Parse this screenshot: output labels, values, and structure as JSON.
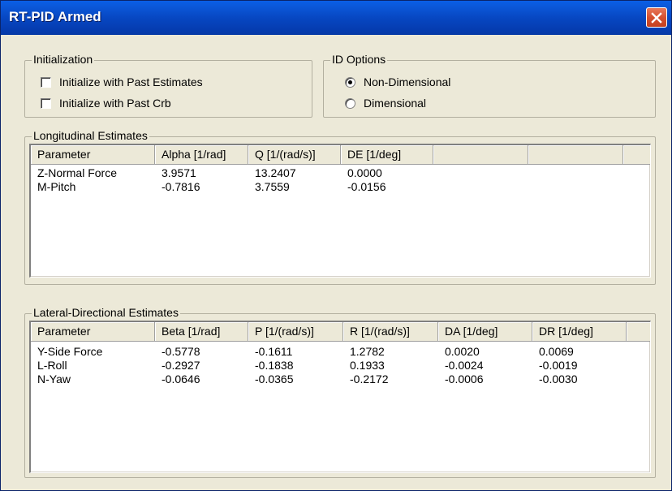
{
  "window": {
    "title": "RT-PID Armed"
  },
  "initialization": {
    "title": "Initialization",
    "options": [
      {
        "label": "Initialize with Past Estimates",
        "checked": false
      },
      {
        "label": "Initialize with Past Crb",
        "checked": false
      }
    ]
  },
  "id_options": {
    "title": "ID Options",
    "options": [
      {
        "label": "Non-Dimensional",
        "selected": true
      },
      {
        "label": "Dimensional",
        "selected": false
      }
    ]
  },
  "longitudinal": {
    "title": "Longitudinal Estimates",
    "columns": [
      "Parameter",
      "Alpha [1/rad]",
      "Q [1/(rad/s)]",
      "DE [1/deg]",
      "",
      ""
    ],
    "rows": [
      [
        "Z-Normal Force",
        "3.9571",
        "13.2407",
        "0.0000"
      ],
      [
        "M-Pitch",
        "-0.7816",
        "3.7559",
        "-0.0156"
      ]
    ]
  },
  "lateral": {
    "title": "Lateral-Directional Estimates",
    "columns": [
      "Parameter",
      "Beta [1/rad]",
      "P [1/(rad/s)]",
      "R [1/(rad/s)]",
      "DA [1/deg]",
      "DR [1/deg]"
    ],
    "rows": [
      [
        "Y-Side Force",
        "-0.5778",
        "-0.1611",
        "1.2782",
        "0.0020",
        "0.0069"
      ],
      [
        "L-Roll",
        "-0.2927",
        "-0.1838",
        "0.1933",
        "-0.0024",
        "-0.0019"
      ],
      [
        "N-Yaw",
        "-0.0646",
        "-0.0365",
        "-0.2172",
        "-0.0006",
        "-0.0030"
      ]
    ]
  }
}
